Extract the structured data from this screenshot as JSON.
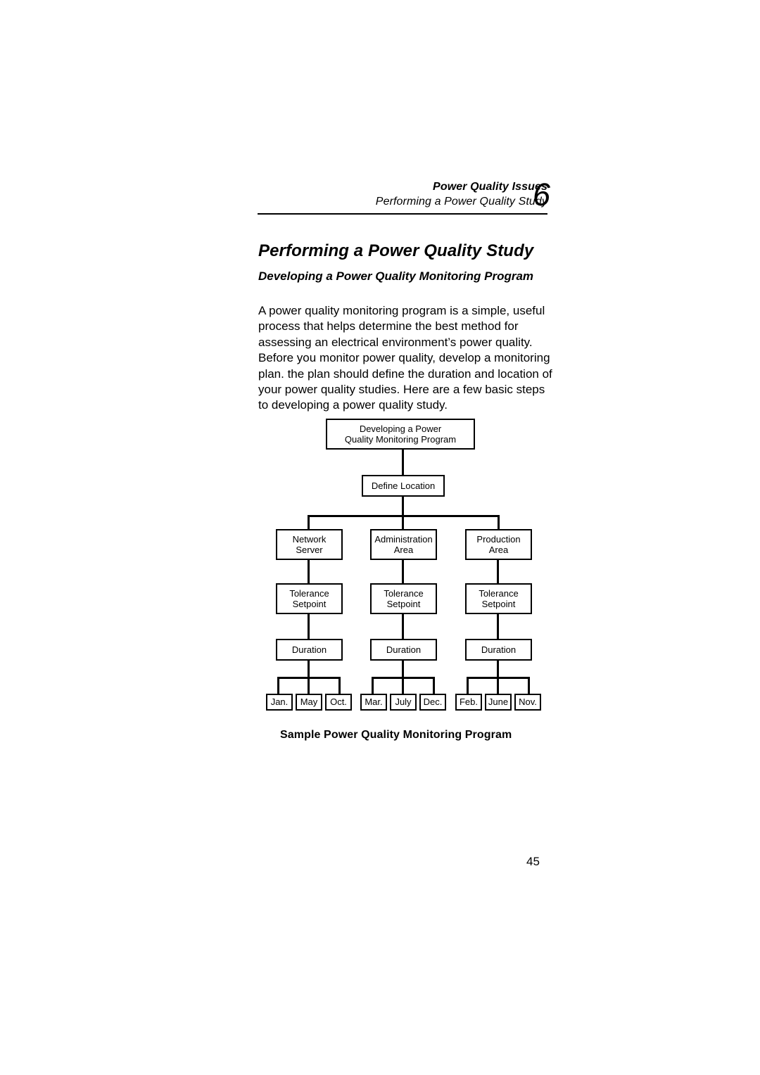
{
  "header": {
    "line1": "Power Quality Issues",
    "line2": "Performing a Power Quality Study",
    "chapter_number": "6"
  },
  "doc_title": "Performing a Power Quality Study",
  "section_title": "Developing a Power Quality Monitoring Program",
  "body_text": "A power quality monitoring program is a simple, useful process that helps determine the best method for assessing an electrical environment’s power quality. Before you monitor power quality, develop a monitoring plan. the plan should define the duration and location of your power quality studies. Here are a few basic steps to developing a power quality study.",
  "figure": {
    "caption": "Sample Power Quality Monitoring Program",
    "root": "Developing a Power\nQuality Monitoring Program",
    "define_location": "Define Location",
    "branches": [
      {
        "area": "Network\nServer",
        "tolerance": "Tolerance\nSetpoint",
        "duration": "Duration",
        "months": [
          "Jan.",
          "May",
          "Oct."
        ]
      },
      {
        "area": "Administration\nArea",
        "tolerance": "Tolerance\nSetpoint",
        "duration": "Duration",
        "months": [
          "Mar.",
          "July",
          "Dec."
        ]
      },
      {
        "area": "Production\nArea",
        "tolerance": "Tolerance\nSetpoint",
        "duration": "Duration",
        "months": [
          "Feb.",
          "June",
          "Nov."
        ]
      }
    ]
  },
  "page_number": "45",
  "colors": {
    "ink": "#000000",
    "paper": "#ffffff"
  }
}
